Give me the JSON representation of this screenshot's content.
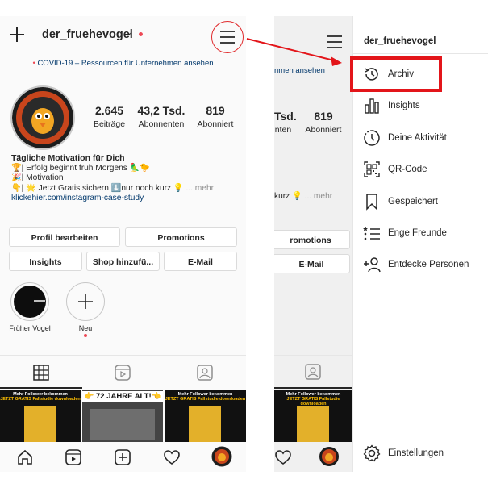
{
  "left": {
    "username": "der_fruehevogel",
    "covid_banner": "COVID-19 – Ressourcen für Unternehmen ansehen",
    "stats": [
      {
        "num": "2.645",
        "label": "Beiträge"
      },
      {
        "num": "43,2 Tsd.",
        "label": "Abonnenten"
      },
      {
        "num": "819",
        "label": "Abonniert"
      }
    ],
    "bio": {
      "name": "Tägliche Motivation für Dich",
      "line1": "🏆| Erfolg beginnt früh Morgens 🦜🐤",
      "line2": "🎉| Motivation",
      "line3": "👇| 🌟 Jetzt Gratis sichern ⬇️nur noch kurz 💡",
      "more": "... mehr",
      "link": "klickehier.com/instagram-case-study"
    },
    "buttons": {
      "edit_profile": "Profil bearbeiten",
      "promotions": "Promotions",
      "insights": "Insights",
      "shop": "Shop hinzufü...",
      "email": "E-Mail"
    },
    "highlights": [
      {
        "label": "Früher Vogel"
      },
      {
        "label": "Neu"
      }
    ],
    "thumbs": {
      "promo_line1": "Mehr Follower bekommen",
      "promo_line2": "JETZT GRATIS Fallstudie downloaden",
      "gym_banner": "👉 72 JAHRE ALT!👈"
    }
  },
  "right": {
    "bg": {
      "covid_partial": "nmen ansehen",
      "stat1_num": "Tsd.",
      "stat1_label": "nten",
      "stat2_num": "819",
      "stat2_label": "Abonniert",
      "bio_partial": "kurz 💡",
      "more": "... mehr",
      "promotions_partial": "romotions",
      "email": "E-Mail"
    },
    "drawer": {
      "title": "der_fruehevogel",
      "items": [
        {
          "label": "Archiv",
          "icon": "archive-icon"
        },
        {
          "label": "Insights",
          "icon": "insights-icon"
        },
        {
          "label": "Deine Aktivität",
          "icon": "activity-icon"
        },
        {
          "label": "QR-Code",
          "icon": "qr-code-icon"
        },
        {
          "label": "Gespeichert",
          "icon": "bookmark-icon"
        },
        {
          "label": "Enge Freunde",
          "icon": "close-friends-icon"
        },
        {
          "label": "Entdecke Personen",
          "icon": "add-person-icon"
        }
      ],
      "settings": "Einstellungen"
    }
  },
  "colors": {
    "annotation_red": "#e3151a",
    "link_blue": "#00376b",
    "notification_red": "#ed4956"
  }
}
